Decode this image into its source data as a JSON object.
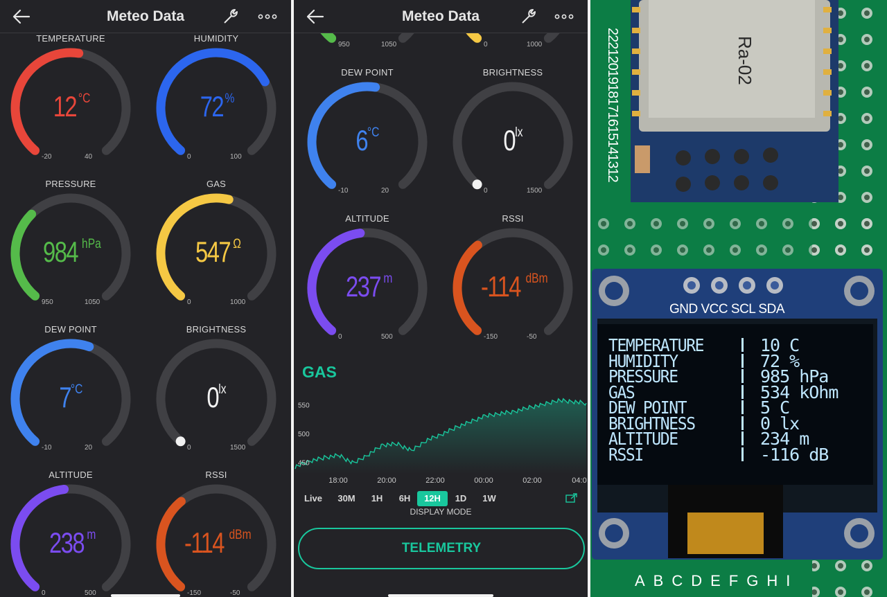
{
  "app": {
    "title": "Meteo Data"
  },
  "colors": {
    "background": "#232327",
    "track": "#404044",
    "red": "#e8463a",
    "blue": "#2c66ee",
    "green": "#55bb4a",
    "yellow": "#f5c844",
    "lightblue": "#3f82ee",
    "white": "#f2f2f2",
    "purple": "#7b4cf0",
    "orange": "#d9541f",
    "accent": "#19c79d"
  },
  "screen1": {
    "gauges": [
      {
        "label": "TEMPERATURE",
        "value": "12",
        "unit": "°C",
        "min": "-20",
        "max": "40",
        "fraction": 0.53,
        "color": "red"
      },
      {
        "label": "HUMIDITY",
        "value": "72",
        "unit": "%",
        "min": "0",
        "max": "100",
        "fraction": 0.72,
        "color": "blue"
      },
      {
        "label": "PRESSURE",
        "value": "984",
        "unit": "hPa",
        "min": "950",
        "max": "1050",
        "fraction": 0.34,
        "color": "green"
      },
      {
        "label": "GAS",
        "value": "547",
        "unit": "Ω",
        "min": "0",
        "max": "1000",
        "fraction": 0.547,
        "color": "yellow"
      },
      {
        "label": "DEW POINT",
        "value": "7",
        "unit": "°C",
        "min": "-10",
        "max": "20",
        "fraction": 0.57,
        "color": "lightblue"
      },
      {
        "label": "BRIGHTNESS",
        "value": "0",
        "unit": "lx",
        "min": "0",
        "max": "1500",
        "fraction": 0.0,
        "color": "white"
      },
      {
        "label": "ALTITUDE",
        "value": "238",
        "unit": "m",
        "min": "0",
        "max": "500",
        "fraction": 0.476,
        "color": "purple"
      },
      {
        "label": "RSSI",
        "value": "-114",
        "unit": "dBm",
        "min": "-150",
        "max": "-50",
        "fraction": 0.36,
        "color": "orange"
      }
    ]
  },
  "screen2": {
    "partial_top": [
      {
        "min": "950",
        "max": "1050",
        "color": "green"
      },
      {
        "min": "0",
        "max": "1000",
        "color": "yellow"
      }
    ],
    "gauges": [
      {
        "label": "DEW POINT",
        "value": "6",
        "unit": "°C",
        "min": "-10",
        "max": "20",
        "fraction": 0.53,
        "color": "lightblue"
      },
      {
        "label": "BRIGHTNESS",
        "value": "0",
        "unit": "lx",
        "min": "0",
        "max": "1500",
        "fraction": 0.0,
        "color": "white"
      },
      {
        "label": "ALTITUDE",
        "value": "237",
        "unit": "m",
        "min": "0",
        "max": "500",
        "fraction": 0.474,
        "color": "purple"
      },
      {
        "label": "RSSI",
        "value": "-114",
        "unit": "dBm",
        "min": "-150",
        "max": "-50",
        "fraction": 0.36,
        "color": "orange"
      }
    ],
    "chart": {
      "title": "GAS",
      "y_ticks": [
        "550",
        "500",
        "450"
      ],
      "x_ticks": [
        "18:00",
        "20:00",
        "22:00",
        "00:00",
        "02:00",
        "04:0"
      ],
      "periods": [
        "Live",
        "30M",
        "1H",
        "6H",
        "12H",
        "1D",
        "1W"
      ],
      "active_period": "12H",
      "display_mode_label": "DISPLAY MODE",
      "telemetry_label": "TELEMETRY"
    }
  },
  "chart_data": {
    "type": "area",
    "title": "GAS",
    "x": [
      "16:30",
      "17:00",
      "17:30",
      "17:45",
      "18:00",
      "18:15",
      "18:30",
      "19:00",
      "19:15",
      "19:30",
      "20:00",
      "21:00",
      "22:00",
      "23:00",
      "00:00",
      "01:00",
      "02:00",
      "02:30",
      "03:00",
      "03:30",
      "04:00"
    ],
    "values": [
      442,
      452,
      458,
      462,
      448,
      463,
      480,
      482,
      470,
      488,
      498,
      510,
      520,
      530,
      535,
      538,
      545,
      550,
      558,
      556,
      553
    ],
    "ylim": [
      430,
      570
    ],
    "y_ticks": [
      450,
      500,
      550
    ],
    "color": "#19c79d"
  },
  "photo": {
    "module_label": "Ra-02",
    "pin_labels": "GND VCC SCL SDA",
    "column_letters": "ABCDEFGHI",
    "row_numbers": "2221201918171615141312",
    "oled": [
      {
        "name": "TEMPERATURE",
        "value": "10 C"
      },
      {
        "name": "HUMIDITY",
        "value": "72 %"
      },
      {
        "name": "PRESSURE",
        "value": "985 hPa"
      },
      {
        "name": "GAS",
        "value": "534 kOhm"
      },
      {
        "name": "DEW POINT",
        "value": "5 C"
      },
      {
        "name": "BRIGHTNESS",
        "value": "0 lx"
      },
      {
        "name": "ALTITUDE",
        "value": "234 m"
      },
      {
        "name": "RSSI",
        "value": "-116 dB"
      }
    ]
  }
}
